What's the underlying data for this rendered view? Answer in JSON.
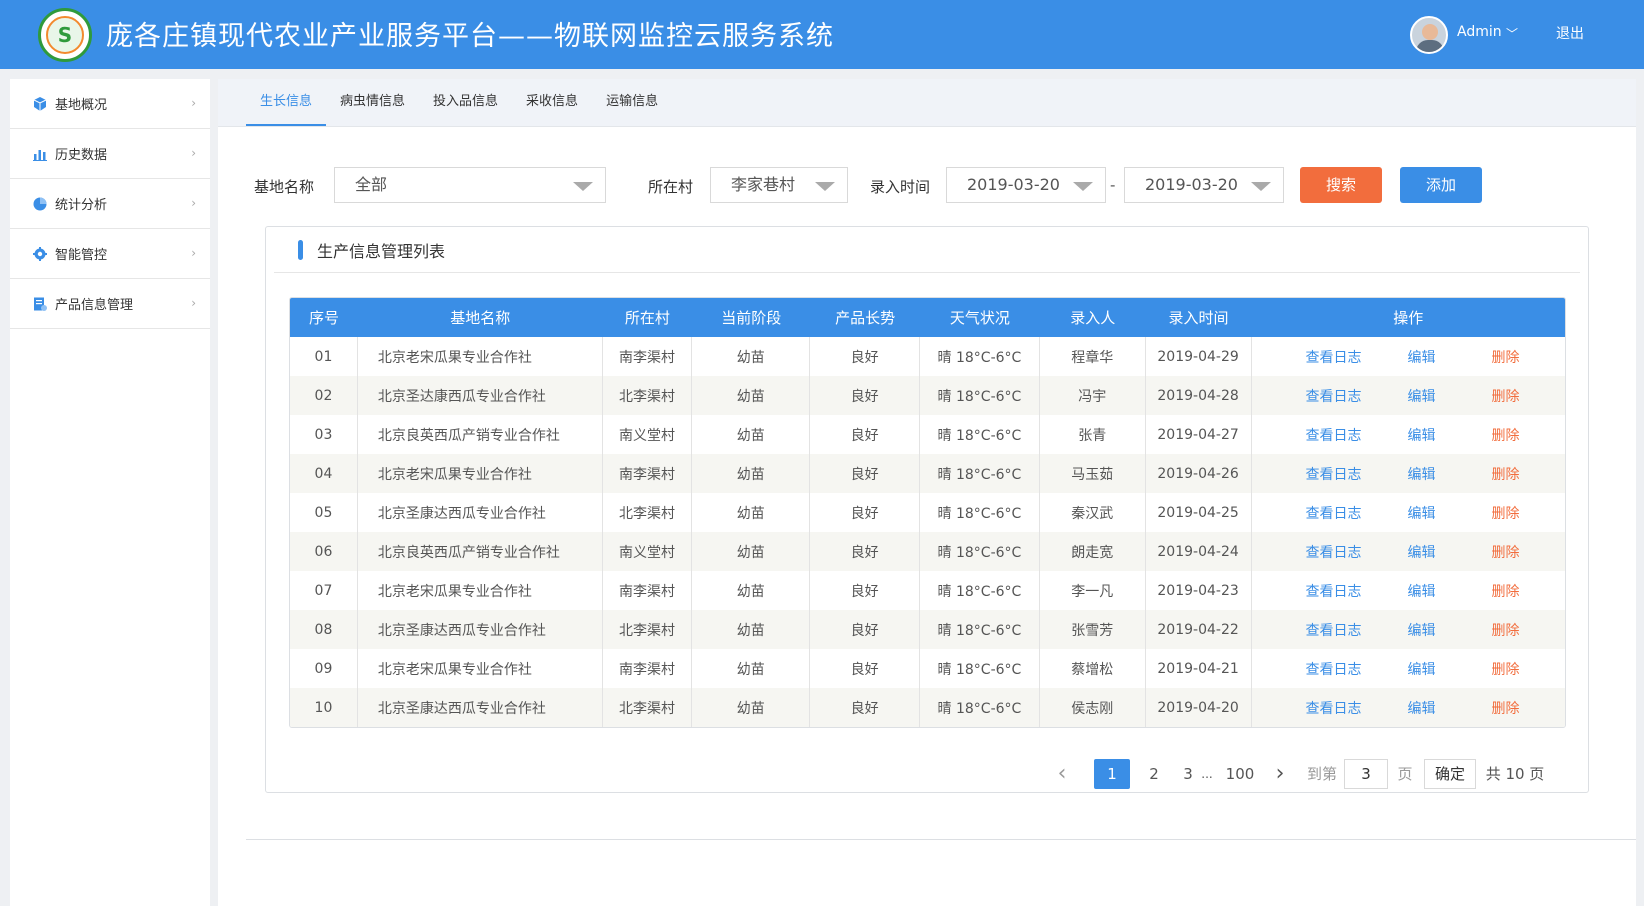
{
  "header": {
    "title": "庞各庄镇现代农业产业服务平台——物联网监控云服务系统",
    "logo_glyph": "S",
    "user": "Admin",
    "logout": "退出"
  },
  "sidebar": {
    "items": [
      {
        "label": "基地概况",
        "icon": "cube-icon"
      },
      {
        "label": "历史数据",
        "icon": "bar-chart-icon"
      },
      {
        "label": "统计分析",
        "icon": "pie-chart-icon"
      },
      {
        "label": "智能管控",
        "icon": "gear-icon"
      },
      {
        "label": "产品信息管理",
        "icon": "document-icon"
      }
    ]
  },
  "tabs": [
    "生长信息",
    "病虫情信息",
    "投入品信息",
    "采收信息",
    "运输信息"
  ],
  "filters": {
    "base_label": "基地名称",
    "base_value": "全部",
    "village_label": "所在村",
    "village_value": "李家巷村",
    "time_label": "录入时间",
    "date_from": "2019-03-20",
    "date_sep": "-",
    "date_to": "2019-03-20",
    "search": "搜索",
    "add": "添加"
  },
  "panel": {
    "title": "生产信息管理列表"
  },
  "table": {
    "headers": [
      "序号",
      "基地名称",
      "所在村",
      "当前阶段",
      "产品长势",
      "天气状况",
      "录入人",
      "录入时间",
      "操作"
    ],
    "op_labels": {
      "log": "查看日志",
      "edit": "编辑",
      "delete": "删除"
    },
    "rows": [
      [
        "01",
        "北京老宋瓜果专业合作社",
        "南李渠村",
        "幼苗",
        "良好",
        "晴 18°C-6°C",
        "程章华",
        "2019-04-29"
      ],
      [
        "02",
        "北京圣达康西瓜专业合作社",
        "北李渠村",
        "幼苗",
        "良好",
        "晴 18°C-6°C",
        "冯宇",
        "2019-04-28"
      ],
      [
        "03",
        "北京良英西瓜产销专业合作社",
        "南义堂村",
        "幼苗",
        "良好",
        "晴 18°C-6°C",
        "张青",
        "2019-04-27"
      ],
      [
        "04",
        "北京老宋瓜果专业合作社",
        "南李渠村",
        "幼苗",
        "良好",
        "晴 18°C-6°C",
        "马玉茹",
        "2019-04-26"
      ],
      [
        "05",
        "北京圣康达西瓜专业合作社",
        "北李渠村",
        "幼苗",
        "良好",
        "晴 18°C-6°C",
        "秦汉武",
        "2019-04-25"
      ],
      [
        "06",
        "北京良英西瓜产销专业合作社",
        "南义堂村",
        "幼苗",
        "良好",
        "晴 18°C-6°C",
        "朗走宽",
        "2019-04-24"
      ],
      [
        "07",
        "北京老宋瓜果专业合作社",
        "南李渠村",
        "幼苗",
        "良好",
        "晴 18°C-6°C",
        "李一凡",
        "2019-04-23"
      ],
      [
        "08",
        "北京圣康达西瓜专业合作社",
        "北李渠村",
        "幼苗",
        "良好",
        "晴 18°C-6°C",
        "张雪芳",
        "2019-04-22"
      ],
      [
        "09",
        "北京老宋瓜果专业合作社",
        "南李渠村",
        "幼苗",
        "良好",
        "晴 18°C-6°C",
        "蔡增松",
        "2019-04-21"
      ],
      [
        "10",
        "北京圣康达西瓜专业合作社",
        "北李渠村",
        "幼苗",
        "良好",
        "晴 18°C-6°C",
        "侯志刚",
        "2019-04-20"
      ]
    ]
  },
  "pagination": {
    "prev": "‹",
    "pages": [
      "1",
      "2",
      "3"
    ],
    "ellipsis": "...",
    "last": "100",
    "next": "›",
    "goto_label": "到第",
    "goto_value": "3",
    "page_unit": "页",
    "confirm": "确定",
    "total": "共 10 页"
  },
  "colors": {
    "primary": "#3a8ee6",
    "accent": "#f26d3d"
  }
}
